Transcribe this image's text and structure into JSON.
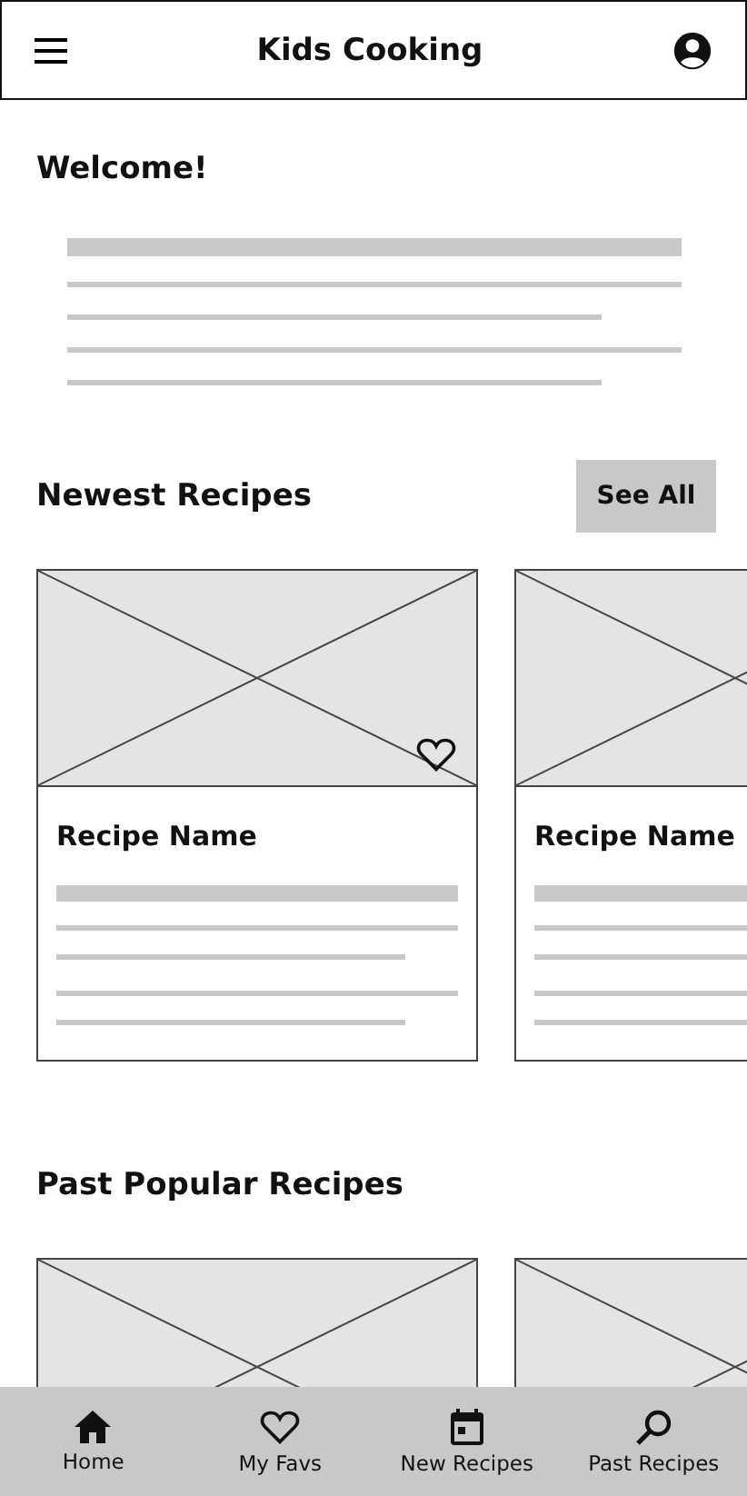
{
  "header": {
    "title": "Kids Cooking"
  },
  "welcome": {
    "title": "Welcome!"
  },
  "sections": [
    {
      "title": "Newest Recipes",
      "button": "See All",
      "cards": [
        {
          "kind": "full",
          "name": "Recipe Name",
          "heart": true
        },
        {
          "kind": "full",
          "name": "Recipe Name"
        }
      ]
    },
    {
      "title": "Past Popular Recipes",
      "cards": [
        {
          "kind": "image"
        },
        {
          "kind": "image"
        }
      ]
    }
  ],
  "nav": [
    {
      "label": "Home"
    },
    {
      "label": "My Favs"
    },
    {
      "label": "New Recipes"
    },
    {
      "label": "Past Recipes"
    }
  ]
}
